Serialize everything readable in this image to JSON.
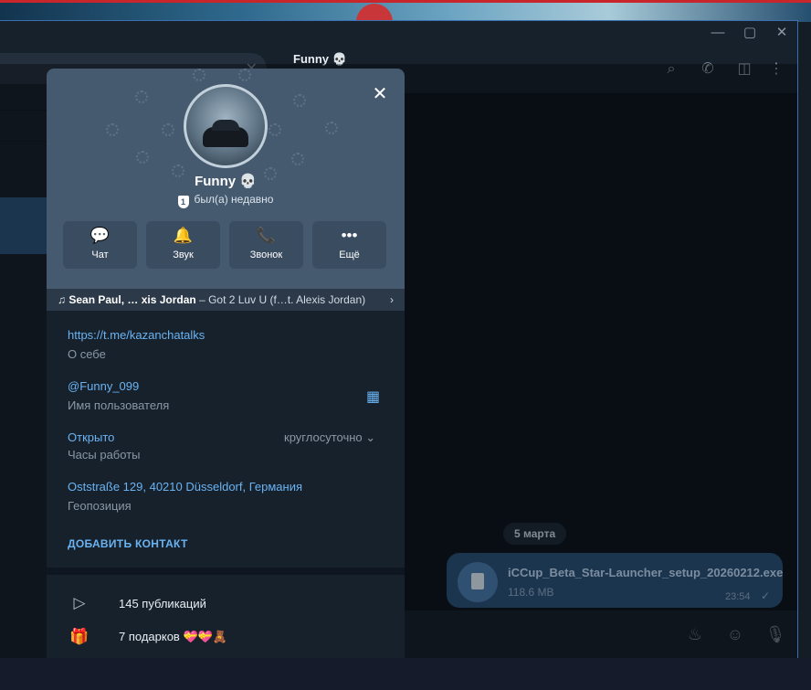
{
  "window": {
    "min_icon": "minimize-icon",
    "max_icon": "maximize-icon",
    "close_icon": "close-icon"
  },
  "chat": {
    "title": "Funny 💀",
    "date_pill": "5 марта",
    "message": {
      "file_name": "iCCup_Beta_Star-Launcher_setup_20260212.exe",
      "file_size": "118.6 MB",
      "time": "23:54",
      "status_icon": "check-icon"
    }
  },
  "profile": {
    "name": "Funny 💀",
    "status": "был(а) недавно",
    "actions": [
      {
        "label": "Чат",
        "icon": "💬"
      },
      {
        "label": "Звук",
        "icon": "🔔"
      },
      {
        "label": "Звонок",
        "icon": "📞"
      },
      {
        "label": "Ещё",
        "icon": "•••"
      }
    ],
    "music": {
      "artist": "Sean Paul, … xis Jordan",
      "title": " – Got 2 Luv U (f…t. Alexis Jordan)"
    },
    "bio": {
      "value": "https://t.me/kazanchatalks",
      "label": "О себе"
    },
    "username": {
      "value": "@Funny_099",
      "label": "Имя пользователя"
    },
    "hours": {
      "value": "Открыто",
      "label": "Часы работы",
      "schedule": "круглосуточно"
    },
    "location": {
      "value": "Oststraße 129, 40210 Düsseldorf, Германия",
      "label": "Геопозиция"
    },
    "add_contact": "ДОБАВИТЬ КОНТАКТ",
    "posts": "145 публикаций",
    "gifts": "7 подарков 💝💝🧸"
  },
  "colors": {
    "accent": "#6ab3f3",
    "header_bg": "#45596f",
    "panel_bg": "#17212b",
    "bubble": "#2b5278"
  }
}
